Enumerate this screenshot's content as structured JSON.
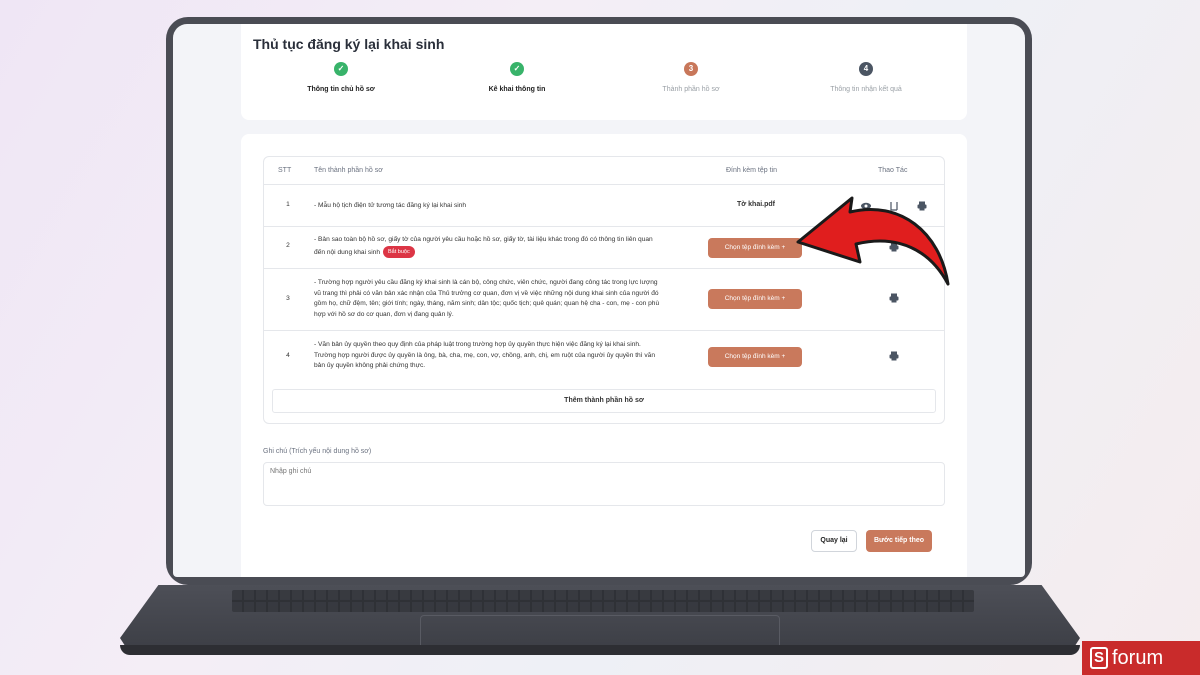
{
  "page_title": "Thủ tục đăng ký lại khai sinh",
  "steps": [
    {
      "number": "1",
      "label": "Thông tin chủ hồ sơ",
      "status": "done"
    },
    {
      "number": "2",
      "label": "Kê khai thông tin",
      "status": "done"
    },
    {
      "number": "3",
      "label": "Thành phần hồ sơ",
      "status": "current"
    },
    {
      "number": "4",
      "label": "Thông tin nhận kết quả",
      "status": "todo"
    }
  ],
  "table": {
    "headers": {
      "stt": "STT",
      "name": "Tên thành phần hồ sơ",
      "attach": "Đính kèm tệp tin",
      "actions": "Thao Tác"
    },
    "rows": [
      {
        "stt": "1",
        "text": "- Mẫu hộ tịch điện tử tương tác đăng ký lại khai sinh",
        "file": "Tờ khai.pdf"
      },
      {
        "stt": "2",
        "text": "- Bản sao toàn bộ hồ sơ, giấy tờ của người yêu cầu hoặc hồ sơ, giấy tờ, tài liệu khác trong đó có thông tin liên quan đến nội dung khai sinh",
        "badge": "Bắt buộc",
        "button": "Chọn tệp đính kèm"
      },
      {
        "stt": "3",
        "text": "- Trường hợp người yêu cầu đăng ký khai sinh là cán bộ, công chức, viên chức, người đang công tác trong lực lượng vũ trang thì phải có văn bản xác nhận của Thủ trưởng cơ quan, đơn vị về việc những nội dung khai sinh của người đó gồm họ, chữ đệm, tên; giới tính; ngày, tháng, năm sinh; dân tộc; quốc tịch; quê quán; quan hệ cha - con, mẹ - con phù hợp với hồ sơ do cơ quan, đơn vị đang quản lý.",
        "button": "Chọn tệp đính kèm"
      },
      {
        "stt": "4",
        "text": "- Văn bản ủy quyền theo quy định của pháp luật trong trường hợp ủy quyền thực hiện việc đăng ký lại khai sinh. Trường hợp người được ủy quyền là ông, bà, cha, mẹ, con, vợ, chồng, anh, chị, em ruột của người ủy quyền thì văn bản ủy quyền không phải chứng thực.",
        "button": "Chọn tệp đính kèm"
      }
    ],
    "add_row_label": "Thêm thành phần hồ sơ"
  },
  "note": {
    "label": "Ghi chú (Trích yếu nội dung hồ sơ)",
    "placeholder": "Nhập ghi chú"
  },
  "buttons": {
    "back": "Quay lại",
    "next": "Bước tiếp theo"
  },
  "colors": {
    "accent": "#c9795c",
    "done": "#38b36a",
    "required": "#dc3545",
    "arrow": "#e01e1e"
  },
  "watermark": {
    "mark": "S",
    "word": "forum"
  }
}
